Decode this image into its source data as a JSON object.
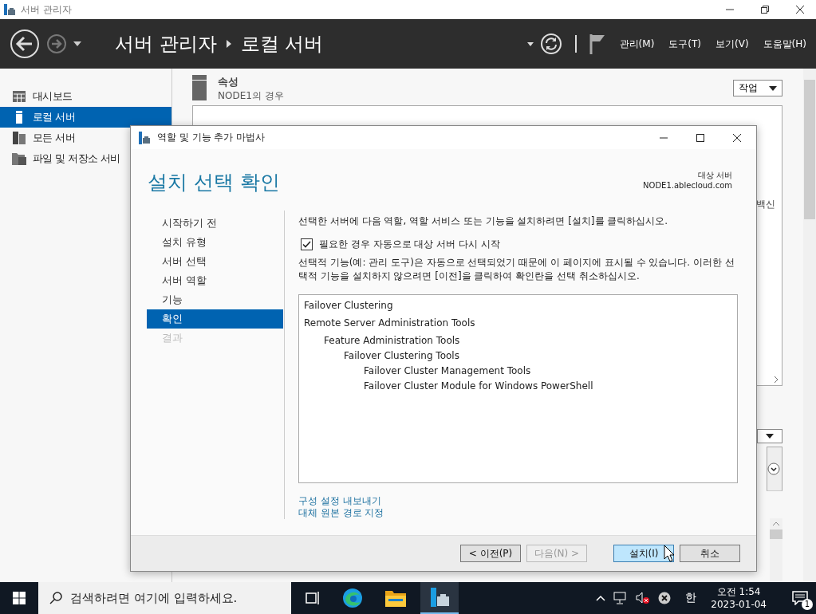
{
  "main_window": {
    "title": "서버 관리자"
  },
  "header": {
    "breadcrumb": [
      "서버 관리자",
      "로컬 서버"
    ],
    "menus": [
      "관리(M)",
      "도구(T)",
      "보기(V)",
      "도움말(H)"
    ]
  },
  "sidebar": {
    "items": [
      {
        "label": "대시보드",
        "selected": false
      },
      {
        "label": "로컬 서버",
        "selected": true
      },
      {
        "label": "모든 서버",
        "selected": false
      },
      {
        "label": "파일 및 저장소 서비",
        "selected": false
      }
    ]
  },
  "properties": {
    "title": "속성",
    "subtitle": "NODE1의 경우",
    "tasks_button": "작업",
    "column_fragment": "백신"
  },
  "dialog": {
    "title": "역할 및 기능 추가 마법사",
    "heading": "설치 선택 확인",
    "target_label": "대상 서버",
    "target_value": "NODE1.ablecloud.com",
    "steps": [
      {
        "label": "시작하기 전",
        "selected": false,
        "disabled": false
      },
      {
        "label": "설치 유형",
        "selected": false,
        "disabled": false
      },
      {
        "label": "서버 선택",
        "selected": false,
        "disabled": false
      },
      {
        "label": "서버 역할",
        "selected": false,
        "disabled": false
      },
      {
        "label": "기능",
        "selected": false,
        "disabled": false
      },
      {
        "label": "확인",
        "selected": true,
        "disabled": false
      },
      {
        "label": "결과",
        "selected": false,
        "disabled": true
      }
    ],
    "instruction": "선택한 서버에 다음 역할, 역할 서비스 또는 기능을 설치하려면 [설치]를 클릭하십시오.",
    "restart": {
      "label": "필요한 경우 자동으로 대상 서버 다시 시작",
      "checked": true
    },
    "note": "선택적 기능(예: 관리 도구)은 자동으로 선택되었기 때문에 이 페이지에 표시될 수 있습니다. 이러한 선택적 기능을 설치하지 않으려면 [이전]을 클릭하여 확인란을 선택 취소하십시오.",
    "features": [
      {
        "label": "Failover Clustering"
      },
      {
        "label": "Remote Server Administration Tools",
        "children": [
          {
            "label": "Feature Administration Tools",
            "children": [
              {
                "label": "Failover Clustering Tools",
                "children": [
                  {
                    "label": "Failover Cluster Management Tools"
                  },
                  {
                    "label": "Failover Cluster Module for Windows PowerShell"
                  }
                ]
              }
            ]
          }
        ]
      }
    ],
    "links": [
      "구성 설정 내보내기",
      "대체 원본 경로 지정"
    ],
    "buttons": [
      {
        "label": "< 이전(P)",
        "disabled": false,
        "primary": false
      },
      {
        "label": "다음(N) >",
        "disabled": true,
        "primary": false
      },
      {
        "label": "설치(I)",
        "disabled": false,
        "primary": true
      },
      {
        "label": "취소",
        "disabled": false,
        "primary": false
      }
    ]
  },
  "taskbar": {
    "search_placeholder": "검색하려면 여기에 입력하세요.",
    "ime": "한",
    "time": "오전 1:54",
    "date": "2023-01-04",
    "notification_count": "1"
  }
}
